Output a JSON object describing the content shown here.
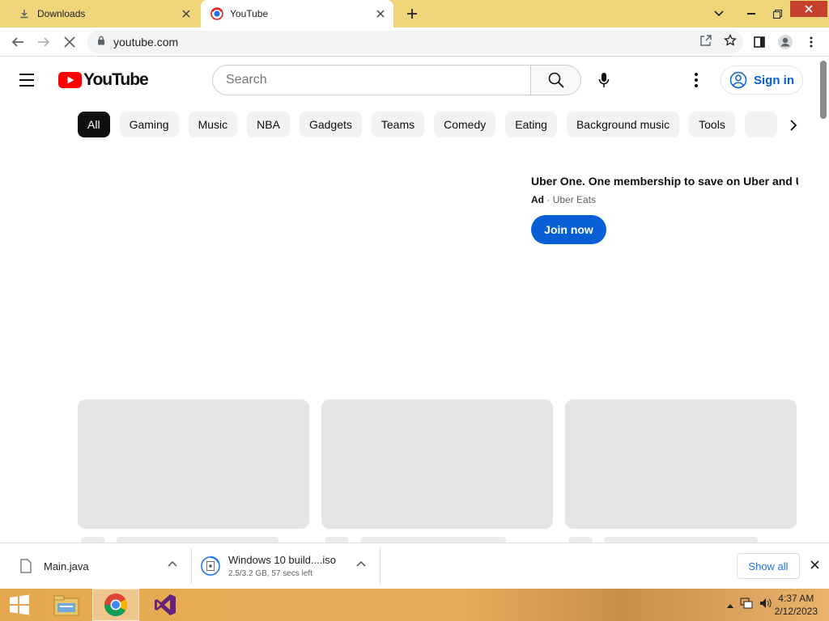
{
  "browser": {
    "tabs": [
      {
        "title": "Downloads",
        "active": false
      },
      {
        "title": "YouTube",
        "active": true
      }
    ],
    "url": "youtube.com"
  },
  "youtube": {
    "logo_text": "YouTube",
    "search_placeholder": "Search",
    "sign_in_label": "Sign in",
    "chips": [
      "All",
      "Gaming",
      "Music",
      "NBA",
      "Gadgets",
      "Teams",
      "Comedy",
      "Eating",
      "Background music",
      "Tools"
    ],
    "active_chip": "All"
  },
  "ad": {
    "title": "Uber One. One membership to save on Uber and Ube",
    "label": "Ad",
    "separator": "·",
    "advertiser": "Uber Eats",
    "cta": "Join now"
  },
  "downloads": {
    "items": [
      {
        "name": "Main.java",
        "status": ""
      },
      {
        "name": "Windows 10 build....iso",
        "status": "2.5/3.2 GB, 57 secs left"
      }
    ],
    "show_all_label": "Show all"
  },
  "taskbar": {
    "time": "4:37 AM",
    "date": "2/12/2023"
  },
  "colors": {
    "tabstrip": "#f1d57a",
    "youtube_red": "#ff0000",
    "link_blue": "#065fd4",
    "skeleton": "#e5e5e5",
    "window_close": "#c7402e"
  },
  "icons": [
    "download-icon",
    "youtube-favicon",
    "close-icon",
    "plus-icon",
    "chevron-down-icon",
    "minimize-icon",
    "restore-icon",
    "back-arrow-icon",
    "forward-arrow-icon",
    "stop-loading-icon",
    "lock-icon",
    "share-icon",
    "star-icon",
    "side-panel-icon",
    "profile-icon",
    "menu-dots-icon",
    "hamburger-icon",
    "search-icon",
    "mic-icon",
    "account-circle-icon",
    "chevron-right-icon",
    "file-icon",
    "iso-file-icon",
    "chevron-up-icon",
    "windows-start-icon",
    "file-explorer-icon",
    "chrome-icon",
    "visual-studio-icon",
    "network-icon",
    "volume-icon"
  ]
}
